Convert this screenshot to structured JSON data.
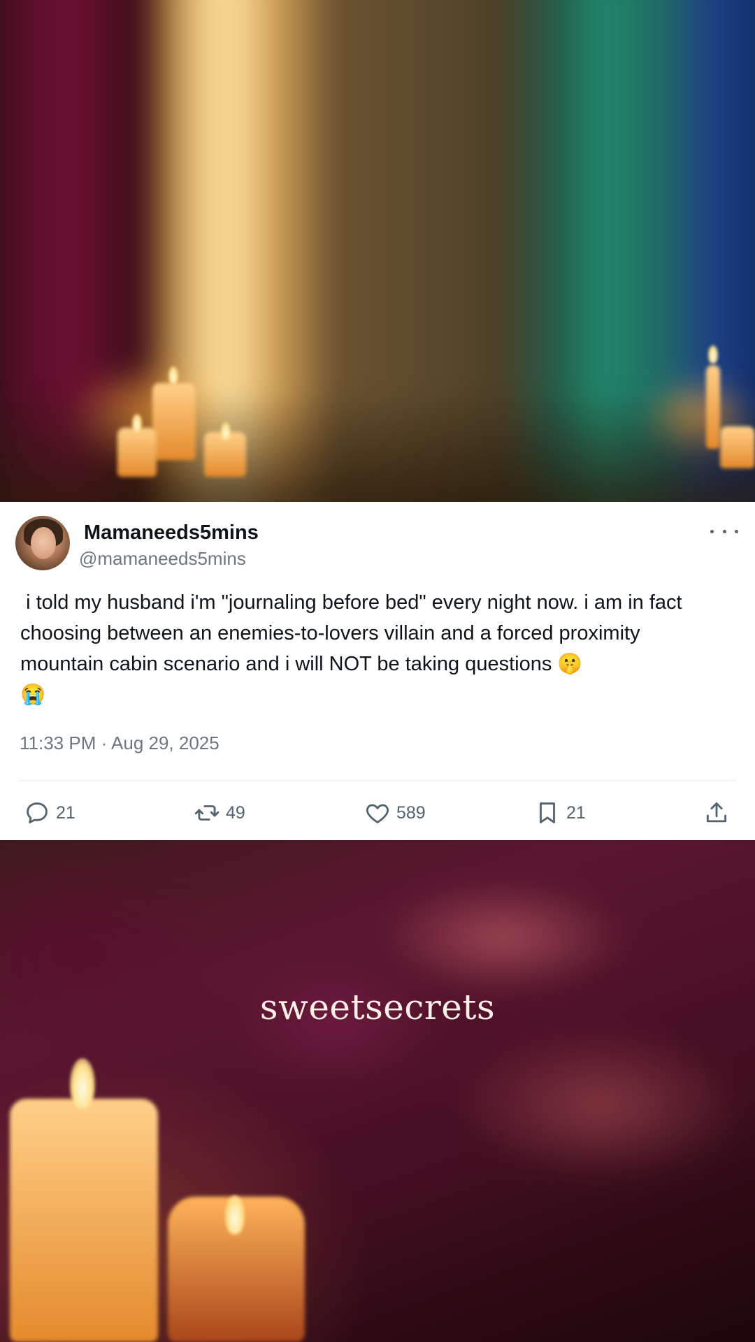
{
  "tweet": {
    "display_name": "Mamaneeds5mins",
    "handle": "@mamaneeds5mins",
    "text": " i told my husband i'm \"journaling before bed\" every night now. i am in fact choosing between an enemies-to-lovers villain and a forced proximity mountain cabin scenario and i will NOT be taking questions 🤫\n😭",
    "timestamp": "11:33 PM · Aug 29, 2025",
    "actions": {
      "replies": "21",
      "reposts": "49",
      "likes": "589",
      "bookmarks": "21"
    }
  },
  "brand": {
    "name": "sweetsecrets"
  },
  "colors": {
    "text_primary": "#0f1419",
    "text_secondary": "#6f7680",
    "icon": "#536471",
    "card_background": "#ffffff"
  },
  "icons": [
    "more-icon",
    "reply-icon",
    "repost-icon",
    "like-icon",
    "bookmark-icon",
    "share-icon"
  ]
}
